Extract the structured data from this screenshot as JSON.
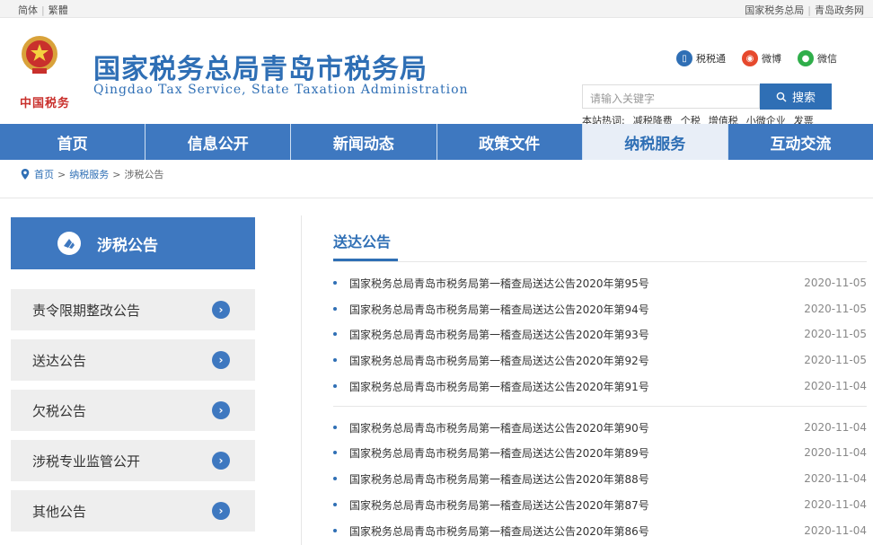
{
  "topbar": {
    "lang_simplified": "简体",
    "lang_traditional": "繁體",
    "link_state": "国家税务总局",
    "link_gov": "青岛政务网"
  },
  "header": {
    "emblem_text": "中国税务",
    "title": "国家税务总局青岛市税务局",
    "subtitle": "Qingdao Tax Service, State Taxation Administration",
    "social": [
      {
        "label": "税税通",
        "icon": "phone-icon",
        "color": "#2f6fb5"
      },
      {
        "label": "微博",
        "icon": "weibo-icon",
        "color": "#e6492d"
      },
      {
        "label": "微信",
        "icon": "wechat-icon",
        "color": "#2fae4a"
      }
    ],
    "search": {
      "placeholder": "请输入关键字",
      "button": "搜索"
    },
    "hot": {
      "label": "本站热词:",
      "words": [
        "减税降费",
        "个税",
        "增值税",
        "小微企业",
        "发票"
      ]
    }
  },
  "nav": {
    "tabs": [
      {
        "label": "首页",
        "active": false
      },
      {
        "label": "信息公开",
        "active": false
      },
      {
        "label": "新闻动态",
        "active": false
      },
      {
        "label": "政策文件",
        "active": false
      },
      {
        "label": "纳税服务",
        "active": true
      },
      {
        "label": "互动交流",
        "active": false
      }
    ]
  },
  "breadcrumb": {
    "home": "首页",
    "sep": ">",
    "section": "纳税服务",
    "current": "涉税公告"
  },
  "sidebar": {
    "heading": "涉税公告",
    "items": [
      {
        "label": "责令限期整改公告"
      },
      {
        "label": "送达公告"
      },
      {
        "label": "欠税公告"
      },
      {
        "label": "涉税专业监管公开"
      },
      {
        "label": "其他公告"
      }
    ]
  },
  "main": {
    "title": "送达公告",
    "items": [
      {
        "title": "国家税务总局青岛市税务局第一稽查局送达公告2020年第95号",
        "date": "2020-11-05"
      },
      {
        "title": "国家税务总局青岛市税务局第一稽查局送达公告2020年第94号",
        "date": "2020-11-05"
      },
      {
        "title": "国家税务总局青岛市税务局第一稽查局送达公告2020年第93号",
        "date": "2020-11-05"
      },
      {
        "title": "国家税务总局青岛市税务局第一稽查局送达公告2020年第92号",
        "date": "2020-11-05"
      },
      {
        "title": "国家税务总局青岛市税务局第一稽查局送达公告2020年第91号",
        "date": "2020-11-04"
      },
      {
        "title": "国家税务总局青岛市税务局第一稽查局送达公告2020年第90号",
        "date": "2020-11-04"
      },
      {
        "title": "国家税务总局青岛市税务局第一稽查局送达公告2020年第89号",
        "date": "2020-11-04"
      },
      {
        "title": "国家税务总局青岛市税务局第一稽查局送达公告2020年第88号",
        "date": "2020-11-04"
      },
      {
        "title": "国家税务总局青岛市税务局第一稽查局送达公告2020年第87号",
        "date": "2020-11-04"
      },
      {
        "title": "国家税务总局青岛市税务局第一稽查局送达公告2020年第86号",
        "date": "2020-11-04"
      }
    ]
  },
  "colors": {
    "primary": "#2f6fb5",
    "nav": "#3e78c0",
    "red": "#c9302c"
  }
}
